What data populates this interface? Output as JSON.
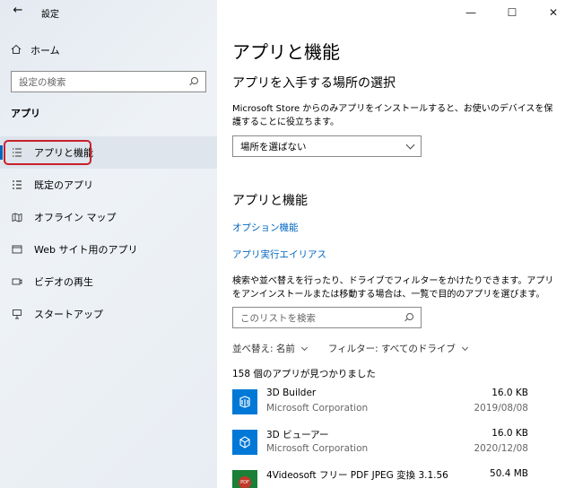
{
  "window": {
    "title": "設定",
    "back_icon": "back-arrow-icon",
    "minimize": "—",
    "maximize": "☐",
    "close": "✕"
  },
  "sidebar": {
    "home_label": "ホーム",
    "search_placeholder": "設定の検索",
    "section_label": "アプリ",
    "items": [
      {
        "label": "アプリと機能",
        "icon": "apps-list-icon",
        "active": true
      },
      {
        "label": "既定のアプリ",
        "icon": "default-apps-icon"
      },
      {
        "label": "オフライン マップ",
        "icon": "offline-map-icon"
      },
      {
        "label": "Web サイト用のアプリ",
        "icon": "website-apps-icon"
      },
      {
        "label": "ビデオの再生",
        "icon": "video-playback-icon"
      },
      {
        "label": "スタートアップ",
        "icon": "startup-icon"
      }
    ]
  },
  "main": {
    "title": "アプリと機能",
    "install_section": {
      "heading": "アプリを入手する場所の選択",
      "description": "Microsoft Store からのみアプリをインストールすると、お使いのデバイスを保護することに役立ちます。",
      "dropdown_value": "場所を選ばない"
    },
    "apps_section": {
      "heading": "アプリと機能",
      "link1": "オプション機能",
      "link2": "アプリ実行エイリアス",
      "description": "検索や並べ替えを行ったり、ドライブでフィルターをかけたりできます。アプリをアンインストールまたは移動する場合は、一覧で目的のアプリを選びます。",
      "search_placeholder": "このリストを検索",
      "sort_label": "並べ替え: 名前",
      "filter_label": "フィルター: すべてのドライブ",
      "count_text": "158 個のアプリが見つかりました"
    },
    "apps": [
      {
        "name": "3D Builder",
        "publisher": "Microsoft Corporation",
        "size": "16.0 KB",
        "date": "2019/08/08"
      },
      {
        "name": "3D ビューアー",
        "publisher": "Microsoft Corporation",
        "size": "16.0 KB",
        "date": "2020/12/08"
      },
      {
        "name": "4Videosoft フリー PDF JPEG 変換 3.1.56",
        "publisher": "",
        "size": "50.4 MB",
        "date": ""
      }
    ],
    "pdf_icon_text": "PDF"
  },
  "colors": {
    "accent": "#0067c0",
    "highlight": "#c8202b",
    "app_tile": "#0078d7"
  }
}
